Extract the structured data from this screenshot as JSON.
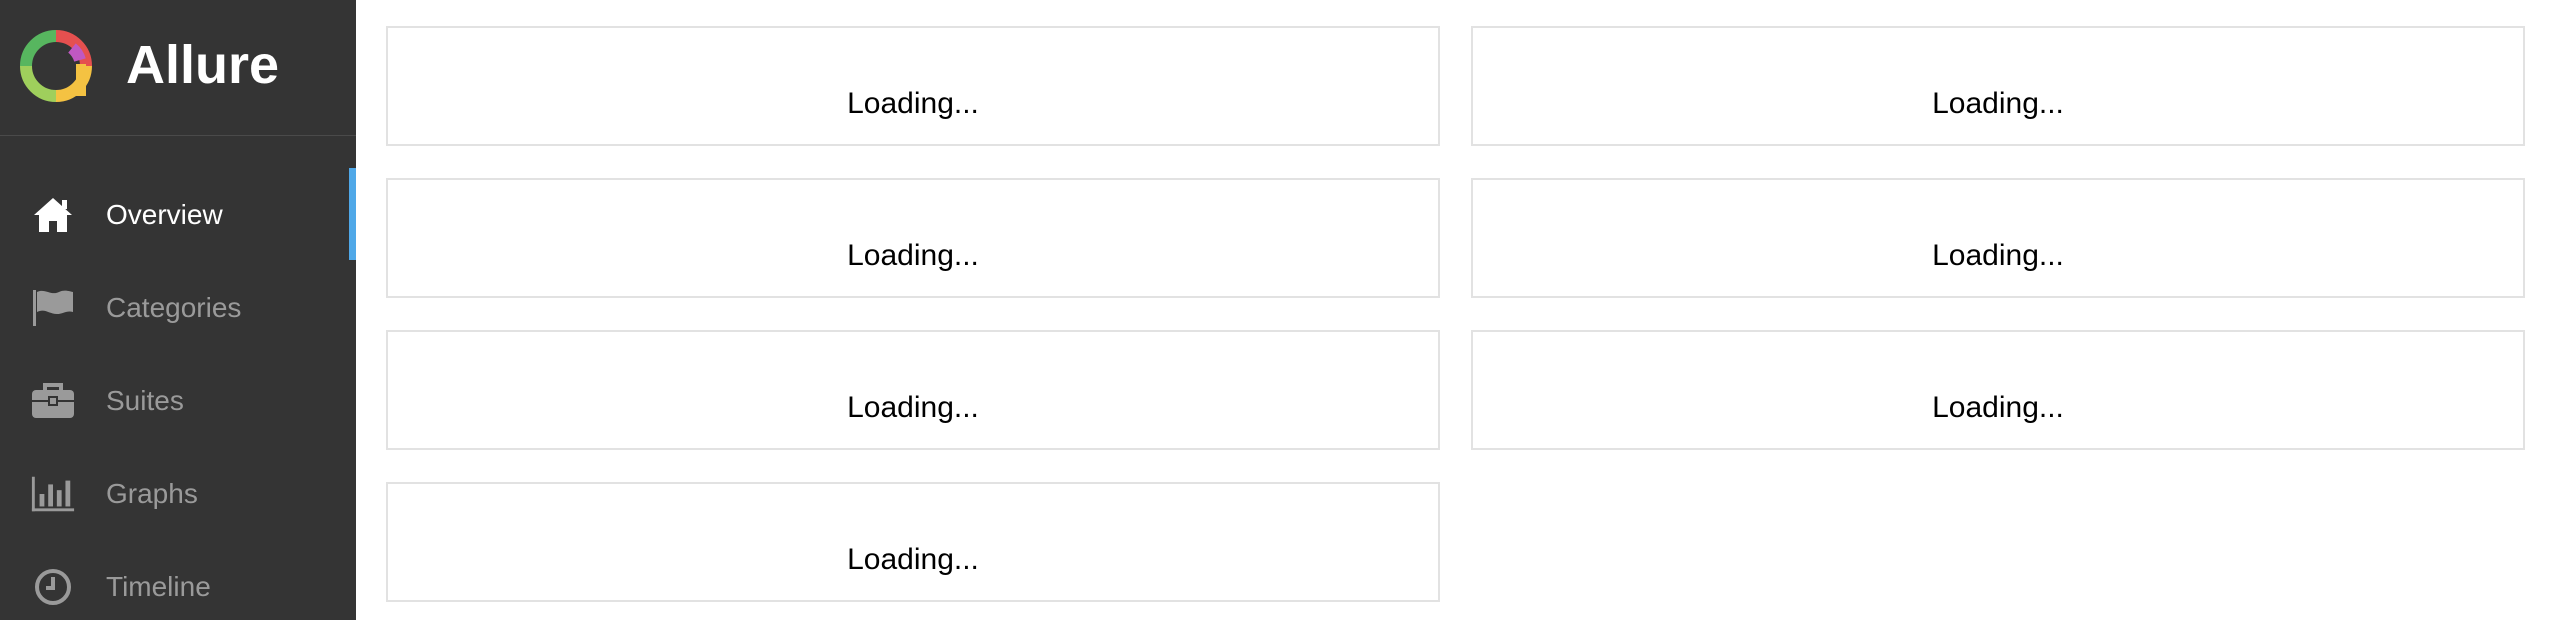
{
  "app": {
    "name": "Allure"
  },
  "sidebar": {
    "items": [
      {
        "label": "Overview",
        "icon": "home-icon",
        "active": true
      },
      {
        "label": "Categories",
        "icon": "flag-icon",
        "active": false
      },
      {
        "label": "Suites",
        "icon": "briefcase-icon",
        "active": false
      },
      {
        "label": "Graphs",
        "icon": "bar-chart-icon",
        "active": false
      },
      {
        "label": "Timeline",
        "icon": "clock-icon",
        "active": false
      }
    ]
  },
  "widgets": [
    {
      "text": "Loading..."
    },
    {
      "text": "Loading..."
    },
    {
      "text": "Loading..."
    },
    {
      "text": "Loading..."
    },
    {
      "text": "Loading..."
    },
    {
      "text": "Loading..."
    },
    {
      "text": "Loading..."
    }
  ],
  "colors": {
    "sidebar_bg": "#343434",
    "active_indicator": "#4fa8e8",
    "nav_text": "#9a9a9a",
    "nav_text_active": "#ffffff"
  }
}
